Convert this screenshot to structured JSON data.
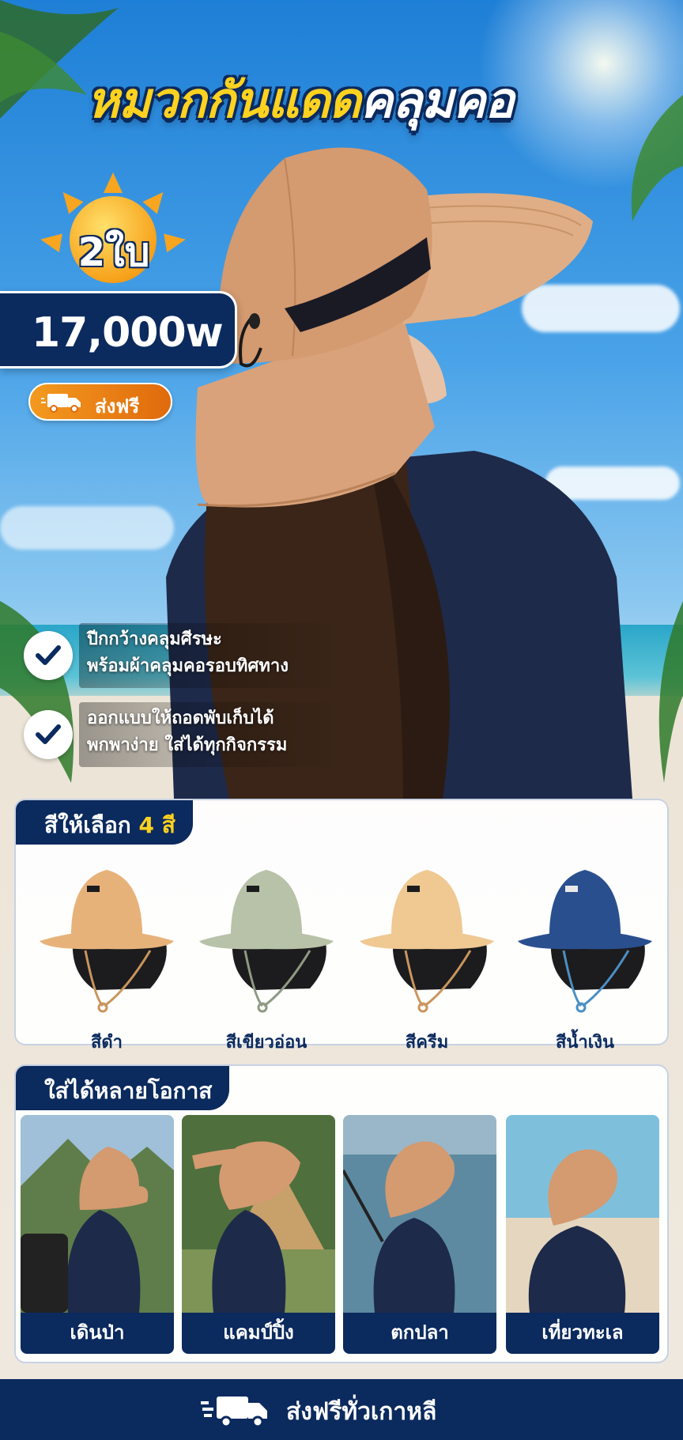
{
  "title": {
    "part1": "หมวกกันแดด",
    "part2": "คลุมคอ"
  },
  "promo": {
    "quantity": "2ใบ",
    "price": "17,000w",
    "shipping": "ส่งฟรี"
  },
  "features": [
    {
      "line1": "ปีกกว้างคลุมศีรษะ",
      "line2": "พร้อมผ้าคลุมคอรอบทิศทาง"
    },
    {
      "line1": "ออกแบบให้ถอดพับเก็บได้",
      "line2": "พกพาง่าย ใส่ได้ทุกกิจกรรม"
    }
  ],
  "colors": {
    "heading_prefix": "สีให้เลือก",
    "heading_count": "4 สี",
    "items": [
      {
        "name": "สีดำ",
        "hat": "#e7b27a",
        "flap": "#1c1c1e",
        "cord": "#c9955c"
      },
      {
        "name": "สีเขียวอ่อน",
        "hat": "#b8c2a8",
        "flap": "#1c1c1e",
        "cord": "#8e9a82"
      },
      {
        "name": "สีครีม",
        "hat": "#efc892",
        "flap": "#1c1c1e",
        "cord": "#c9955c"
      },
      {
        "name": "สีน้ำเงิน",
        "hat": "#2a4f8f",
        "flap": "#1c1c1e",
        "cord": "#4b8fc4"
      }
    ]
  },
  "occasions": {
    "heading": "ใส่ได้หลายโอกาส",
    "items": [
      {
        "label": "เดินป่า",
        "bg_top": "#9fc0d8",
        "bg_bottom": "#5f7d4a"
      },
      {
        "label": "แคมป์ปิ้ง",
        "bg_top": "#4f6f3d",
        "bg_bottom": "#7d9456"
      },
      {
        "label": "ตกปลา",
        "bg_top": "#9ab7c9",
        "bg_bottom": "#5d8aa1"
      },
      {
        "label": "เที่ยวทะเล",
        "bg_top": "#7ec0dc",
        "bg_bottom": "#e5d7bf"
      }
    ]
  },
  "footer": {
    "label": "ส่งฟรีทั่วเกาหลี"
  },
  "theme": {
    "navy": "#0b2a5e",
    "yellow": "#ffd21f",
    "orange": "#f39a1f",
    "hat": "#d9a27a",
    "jacket": "#1e2a4a",
    "hair": "#3a2518"
  }
}
